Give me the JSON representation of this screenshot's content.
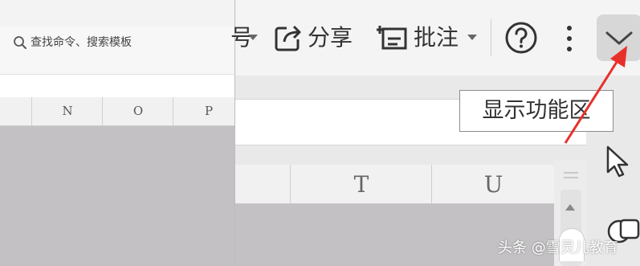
{
  "search": {
    "placeholder": "查找命令、搜索模板"
  },
  "left_columns": [
    "N",
    "O",
    "P"
  ],
  "toolbar": {
    "fragment_label": "号",
    "share_label": "分享",
    "comment_label": "批注",
    "help_icon": "help-circle-icon",
    "more_icon": "more-vertical-icon",
    "collapse_icon": "chevron-down-icon"
  },
  "right_columns": [
    "T",
    "U"
  ],
  "tooltip": {
    "text": "显示功能区"
  },
  "watermark": {
    "text": "头条 @雪灵儿教育"
  },
  "colors": {
    "annotation_arrow": "#e8302a",
    "collapse_button_bg": "#d7d7d7"
  }
}
